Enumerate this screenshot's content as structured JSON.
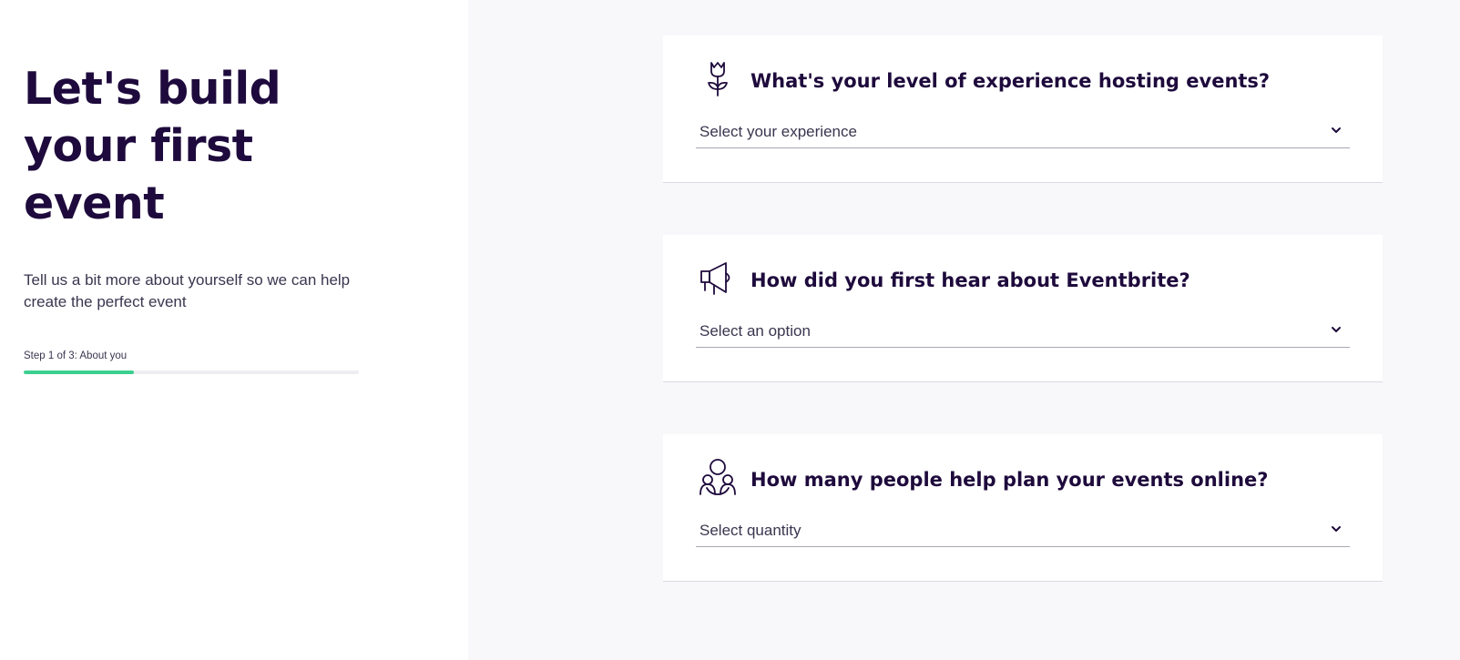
{
  "left": {
    "title": "Let's build your first event",
    "subtitle": "Tell us a bit more about yourself so we can help create the perfect event",
    "step_label": "Step 1 of 3: About you",
    "progress_percent": 33
  },
  "questions": [
    {
      "icon": "tulip-icon",
      "question": "What's your level of experience hosting events?",
      "placeholder": "Select your experience"
    },
    {
      "icon": "megaphone-icon",
      "question": "How did you first hear about Eventbrite?",
      "placeholder": "Select an option"
    },
    {
      "icon": "people-icon",
      "question": "How many people help plan your events online?",
      "placeholder": "Select quantity"
    }
  ],
  "colors": {
    "title": "#1e0a3c",
    "progress": "#3bd08f",
    "right_background": "#f8f7fa"
  }
}
